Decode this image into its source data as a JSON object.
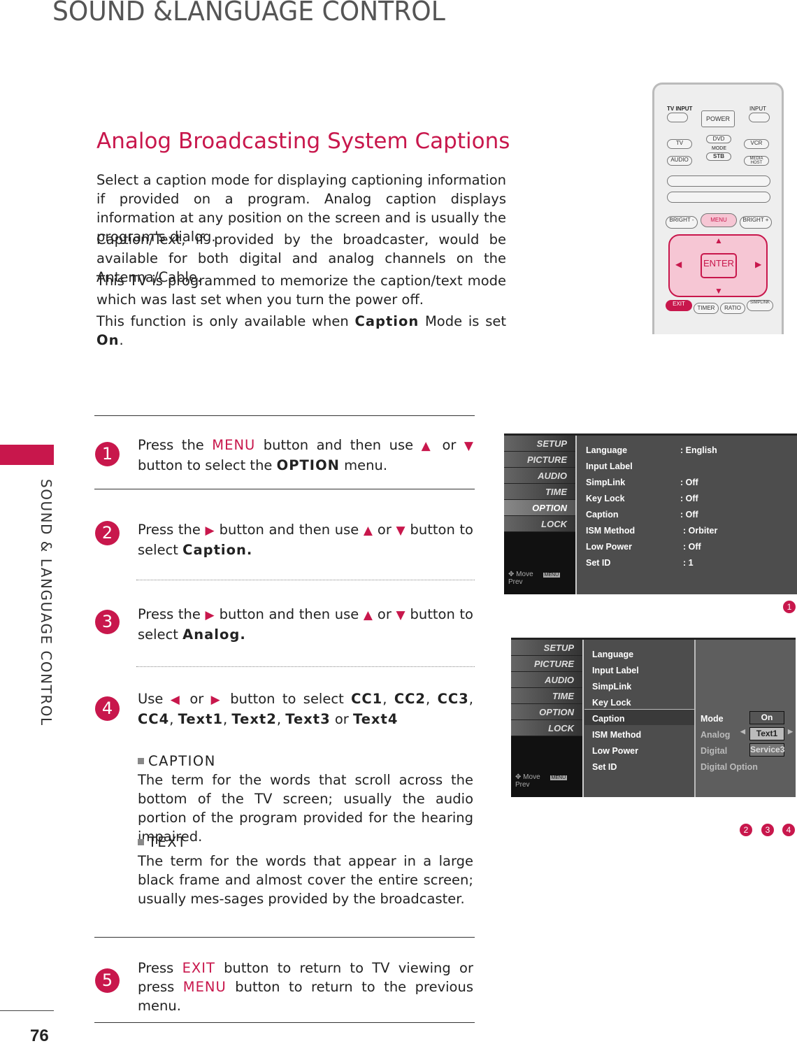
{
  "header": {
    "title": "SOUND &LANGUAGE CONTROL"
  },
  "side": {
    "label": "SOUND & LANGUAGE CONTROL",
    "page_number": "76"
  },
  "section": {
    "title": "Analog Broadcasting System Captions",
    "paragraphs": [
      [
        {
          "t": "Select a caption mode for displaying captioning information if provided on a program. Analog caption displays information at any position on the screen and is usually the program's dialog."
        }
      ],
      [
        {
          "t": "Caption/Text, if provided by the broadcaster, would be available for both digital and analog channels on the Antenna/Cable."
        }
      ],
      [
        {
          "t": "This TV is programmed to memorize the caption/text mode which was last set when you turn the power off."
        }
      ],
      [
        {
          "t": "This function is only available when "
        },
        {
          "t": "Caption",
          "s": "em"
        },
        {
          "t": " Mode is set "
        },
        {
          "t": "On",
          "s": "em"
        },
        {
          "t": "."
        }
      ]
    ]
  },
  "steps": [
    {
      "num": "1",
      "parts": [
        {
          "t": "Press the "
        },
        {
          "t": "MENU",
          "s": "pink"
        },
        {
          "t": " button and then use "
        },
        {
          "t": "▲",
          "s": "arrow"
        },
        {
          "t": " or "
        },
        {
          "t": "▼",
          "s": "arrow"
        },
        {
          "t": " button to select the "
        },
        {
          "t": "OPTION",
          "s": "em"
        },
        {
          "t": " menu."
        }
      ]
    },
    {
      "num": "2",
      "parts": [
        {
          "t": "Press the "
        },
        {
          "t": "▶",
          "s": "arrow"
        },
        {
          "t": " button and then use "
        },
        {
          "t": "▲",
          "s": "arrow"
        },
        {
          "t": " or "
        },
        {
          "t": "▼",
          "s": "arrow"
        },
        {
          "t": " button to select "
        },
        {
          "t": "Caption.",
          "s": "em"
        }
      ]
    },
    {
      "num": "3",
      "parts": [
        {
          "t": "Press the "
        },
        {
          "t": "▶",
          "s": "arrow"
        },
        {
          "t": " button and then use "
        },
        {
          "t": "▲",
          "s": "arrow"
        },
        {
          "t": " or "
        },
        {
          "t": "▼",
          "s": "arrow"
        },
        {
          "t": " button to select "
        },
        {
          "t": "Analog.",
          "s": "em"
        }
      ]
    },
    {
      "num": "4",
      "parts": [
        {
          "t": "Use "
        },
        {
          "t": "◀",
          "s": "arrow"
        },
        {
          "t": " or "
        },
        {
          "t": "▶",
          "s": "arrow"
        },
        {
          "t": " button to select "
        },
        {
          "t": "CC1",
          "s": "em"
        },
        {
          "t": ", "
        },
        {
          "t": "CC2",
          "s": "em"
        },
        {
          "t": ", "
        },
        {
          "t": "CC3",
          "s": "em"
        },
        {
          "t": ", "
        },
        {
          "t": "CC4",
          "s": "em"
        },
        {
          "t": ", "
        },
        {
          "t": "Text1",
          "s": "em"
        },
        {
          "t": ", "
        },
        {
          "t": "Text2",
          "s": "em"
        },
        {
          "t": ", "
        },
        {
          "t": "Text3",
          "s": "em"
        },
        {
          "t": " or "
        },
        {
          "t": "Text4",
          "s": "em"
        }
      ]
    },
    {
      "num": "5",
      "parts": [
        {
          "t": "Press "
        },
        {
          "t": "EXIT",
          "s": "pink"
        },
        {
          "t": " button to return to TV viewing or press "
        },
        {
          "t": "MENU",
          "s": "pink"
        },
        {
          "t": " button to return to the previous menu."
        }
      ]
    }
  ],
  "definitions": [
    {
      "term": "CAPTION",
      "text": "The term for the words that scroll across the bottom of the TV screen; usually the audio portion of the program provided for the hearing impaired."
    },
    {
      "term": "TEXT",
      "text": "The term for the words that appear in a large black frame and almost cover the entire screen; usually mes-sages provided by the broadcaster."
    }
  ],
  "osd_menu": [
    "SETUP",
    "PICTURE",
    "AUDIO",
    "TIME",
    "OPTION",
    "LOCK"
  ],
  "osd_footer": {
    "move": "Move",
    "menu_key": "MENU",
    "prev": "Prev"
  },
  "screen1": {
    "rows": [
      [
        "Language",
        ": English"
      ],
      [
        "Input Label",
        ""
      ],
      [
        "SimpLink",
        ": Off"
      ],
      [
        "Key Lock",
        ": Off"
      ],
      [
        "Caption",
        ": Off"
      ],
      [
        "ISM Method",
        ": Orbiter"
      ],
      [
        "Low Power",
        ": Off"
      ],
      [
        "Set ID",
        ": 1"
      ]
    ],
    "badges": [
      "1"
    ]
  },
  "screen2": {
    "items": [
      "Language",
      "Input Label",
      "SimpLink",
      "Key Lock",
      "Caption",
      "ISM Method",
      "Low Power",
      "Set ID"
    ],
    "sub": [
      {
        "label": "Mode",
        "value": "On"
      },
      {
        "label": "Analog",
        "value": "Text1"
      },
      {
        "label": "Digital",
        "value": "Service3"
      },
      {
        "label": "Digital Option",
        "value": ""
      }
    ],
    "badges": [
      "2",
      "3",
      "4"
    ]
  },
  "remote": {
    "tv_input": "TV INPUT",
    "power": "POWER",
    "input": "INPUT",
    "tv": "TV",
    "dvd": "DVD",
    "vcr": "VCR",
    "mode": "MODE",
    "audio": "AUDIO",
    "stb": "STB",
    "media_host": "MEDIA HOST",
    "bright_minus": "BRIGHT -",
    "menu": "MENU",
    "bright_plus": "BRIGHT +",
    "enter": "ENTER",
    "exit": "EXIT",
    "timer": "TIMER",
    "ratio": "RATIO",
    "simplink": "SIMPLINK"
  },
  "colors": {
    "accent": "#c8174c",
    "osd_bg": "#4d4d4d"
  }
}
